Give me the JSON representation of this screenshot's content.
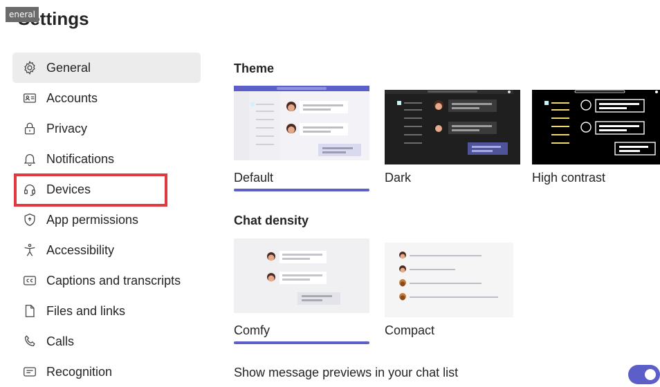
{
  "window": {
    "tab_label": "eneral",
    "title": "Settings"
  },
  "sidebar": {
    "items": [
      {
        "label": "General",
        "icon": "gear-icon",
        "active": true
      },
      {
        "label": "Accounts",
        "icon": "id-card-icon"
      },
      {
        "label": "Privacy",
        "icon": "lock-icon"
      },
      {
        "label": "Notifications",
        "icon": "bell-icon"
      },
      {
        "label": "Devices",
        "icon": "headset-icon",
        "highlighted": true
      },
      {
        "label": "App permissions",
        "icon": "shield-icon"
      },
      {
        "label": "Accessibility",
        "icon": "accessibility-icon"
      },
      {
        "label": "Captions and transcripts",
        "icon": "cc-icon"
      },
      {
        "label": "Files and links",
        "icon": "file-icon"
      },
      {
        "label": "Calls",
        "icon": "phone-icon"
      },
      {
        "label": "Recognition",
        "icon": "recognition-icon"
      }
    ]
  },
  "theme": {
    "title": "Theme",
    "options": [
      {
        "label": "Default",
        "selected": true
      },
      {
        "label": "Dark"
      },
      {
        "label": "High contrast"
      }
    ]
  },
  "chat_density": {
    "title": "Chat density",
    "options": [
      {
        "label": "Comfy",
        "selected": true
      },
      {
        "label": "Compact"
      }
    ]
  },
  "message_previews": {
    "label": "Show message previews in your chat list",
    "enabled": true
  },
  "colors": {
    "accent": "#5b5fc7",
    "highlight": "#e0393e"
  }
}
